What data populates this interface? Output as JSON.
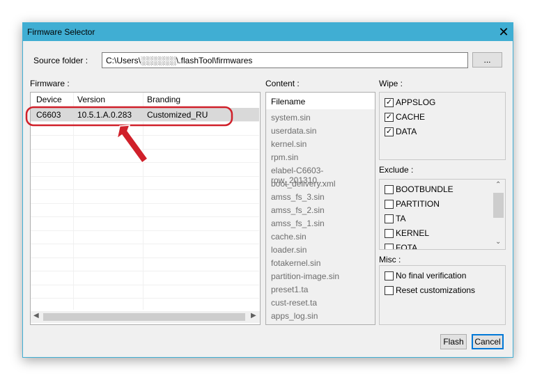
{
  "window": {
    "title": "Firmware Selector",
    "close_icon": "close-icon"
  },
  "source": {
    "label": "Source folder :",
    "value": "C:\\Users\\░░░░░░\\.flashTool\\firmwares",
    "browse_label": "..."
  },
  "firmware": {
    "label": "Firmware :",
    "columns": [
      "Device",
      "Version",
      "Branding"
    ],
    "rows": [
      {
        "device": "C6603",
        "version": "10.5.1.A.0.283",
        "branding": "Customized_RU",
        "selected": true
      }
    ]
  },
  "content": {
    "label": "Content :",
    "header": "Filename",
    "files": [
      "system.sin",
      "userdata.sin",
      "kernel.sin",
      "rpm.sin",
      "elabel-C6603-row_201310...",
      "boot_delivery.xml",
      "amss_fs_3.sin",
      "amss_fs_2.sin",
      "amss_fs_1.sin",
      "cache.sin",
      "loader.sin",
      "fotakernel.sin",
      "partition-image.sin",
      "preset1.ta",
      "cust-reset.ta",
      "apps_log.sin"
    ]
  },
  "wipe": {
    "label": "Wipe :",
    "items": [
      {
        "label": "APPSLOG",
        "checked": true
      },
      {
        "label": "CACHE",
        "checked": true
      },
      {
        "label": "DATA",
        "checked": true
      }
    ]
  },
  "exclude": {
    "label": "Exclude :",
    "items": [
      {
        "label": "BOOTBUNDLE",
        "checked": false
      },
      {
        "label": "PARTITION",
        "checked": false
      },
      {
        "label": "TA",
        "checked": false
      },
      {
        "label": "KERNEL",
        "checked": false
      },
      {
        "label": "FOTA",
        "checked": false
      }
    ]
  },
  "misc": {
    "label": "Misc :",
    "items": [
      {
        "label": "No final verification",
        "checked": false
      },
      {
        "label": "Reset customizations",
        "checked": false
      }
    ]
  },
  "buttons": {
    "flash": "Flash",
    "cancel": "Cancel"
  },
  "annotation": {
    "color": "#d0202a"
  }
}
